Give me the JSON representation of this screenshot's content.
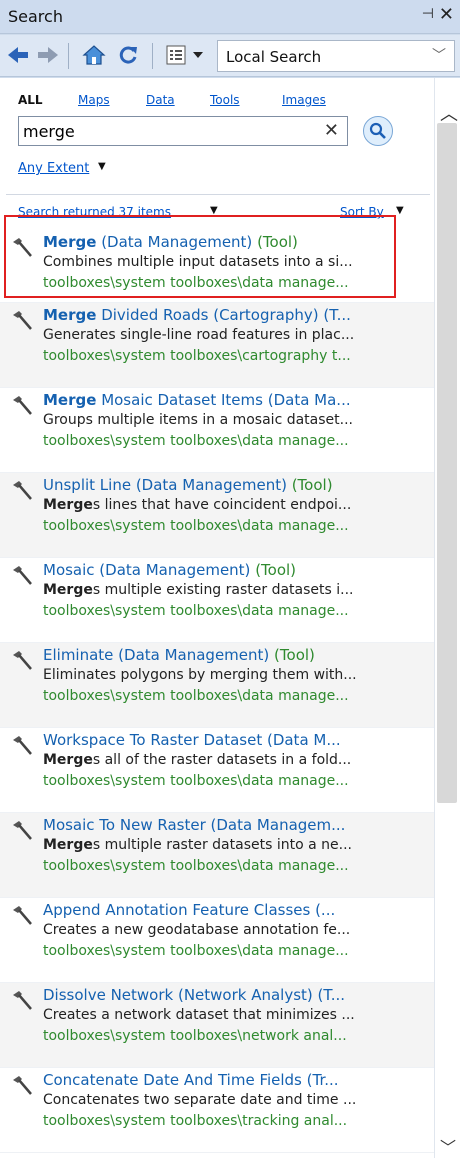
{
  "window": {
    "title": "Search",
    "pin": "⊣",
    "close": "✕"
  },
  "toolbar": {
    "scope": "Local Search"
  },
  "filters": {
    "all": "ALL",
    "maps": "Maps",
    "data": "Data",
    "tools": "Tools",
    "images": "Images"
  },
  "search": {
    "value": "merge"
  },
  "extent": {
    "label": "Any Extent"
  },
  "results": {
    "count_label": "Search returned 37 items",
    "sort_label": "Sort By"
  },
  "items": [
    {
      "bold": "Merge",
      "title": " (Data Management)",
      "suffix": " (Tool)",
      "desc_bold": "",
      "desc": "Combines multiple input datasets into a si...",
      "path": "toolboxes\\system toolboxes\\data manage..."
    },
    {
      "bold": "Merge",
      "title": " Divided Roads (Cartography) (T...",
      "suffix": "",
      "desc_bold": "",
      "desc": "Generates single-line road features in plac...",
      "path": "toolboxes\\system toolboxes\\cartography t..."
    },
    {
      "bold": "Merge",
      "title": " Mosaic Dataset Items (Data Ma...",
      "suffix": "",
      "desc_bold": "",
      "desc": "Groups multiple items in a mosaic dataset...",
      "path": "toolboxes\\system toolboxes\\data manage..."
    },
    {
      "bold": "",
      "title": "Unsplit Line (Data Management)",
      "suffix": " (Tool)",
      "desc_bold": "Merge",
      "desc": "s lines that have coincident endpoi...",
      "path": "toolboxes\\system toolboxes\\data manage..."
    },
    {
      "bold": "",
      "title": "Mosaic (Data Management)",
      "suffix": " (Tool)",
      "desc_bold": "Merge",
      "desc": "s multiple existing raster datasets i...",
      "path": "toolboxes\\system toolboxes\\data manage..."
    },
    {
      "bold": "",
      "title": "Eliminate (Data Management)",
      "suffix": " (Tool)",
      "desc_bold": "",
      "desc": "Eliminates polygons by merging them with...",
      "path": "toolboxes\\system toolboxes\\data manage..."
    },
    {
      "bold": "",
      "title": "Workspace To Raster Dataset (Data M...",
      "suffix": "",
      "desc_bold": "Merge",
      "desc": "s all of the raster datasets in a fold...",
      "path": "toolboxes\\system toolboxes\\data manage..."
    },
    {
      "bold": "",
      "title": "Mosaic To New Raster (Data Managem...",
      "suffix": "",
      "desc_bold": "Merge",
      "desc": "s multiple raster datasets into a ne...",
      "path": "toolboxes\\system toolboxes\\data manage..."
    },
    {
      "bold": "",
      "title": "Append Annotation Feature Classes (...",
      "suffix": "",
      "desc_bold": "",
      "desc": "Creates a new geodatabase annotation fe...",
      "path": "toolboxes\\system toolboxes\\data manage..."
    },
    {
      "bold": "",
      "title": "Dissolve Network (Network Analyst) (T...",
      "suffix": "",
      "desc_bold": "",
      "desc": "Creates a network dataset that minimizes ...",
      "path": "toolboxes\\system toolboxes\\network anal..."
    },
    {
      "bold": "",
      "title": "Concatenate Date And Time Fields (Tr...",
      "suffix": "",
      "desc_bold": "",
      "desc": "Concatenates two separate date and time ...",
      "path": "toolboxes\\system toolboxes\\tracking anal..."
    }
  ]
}
